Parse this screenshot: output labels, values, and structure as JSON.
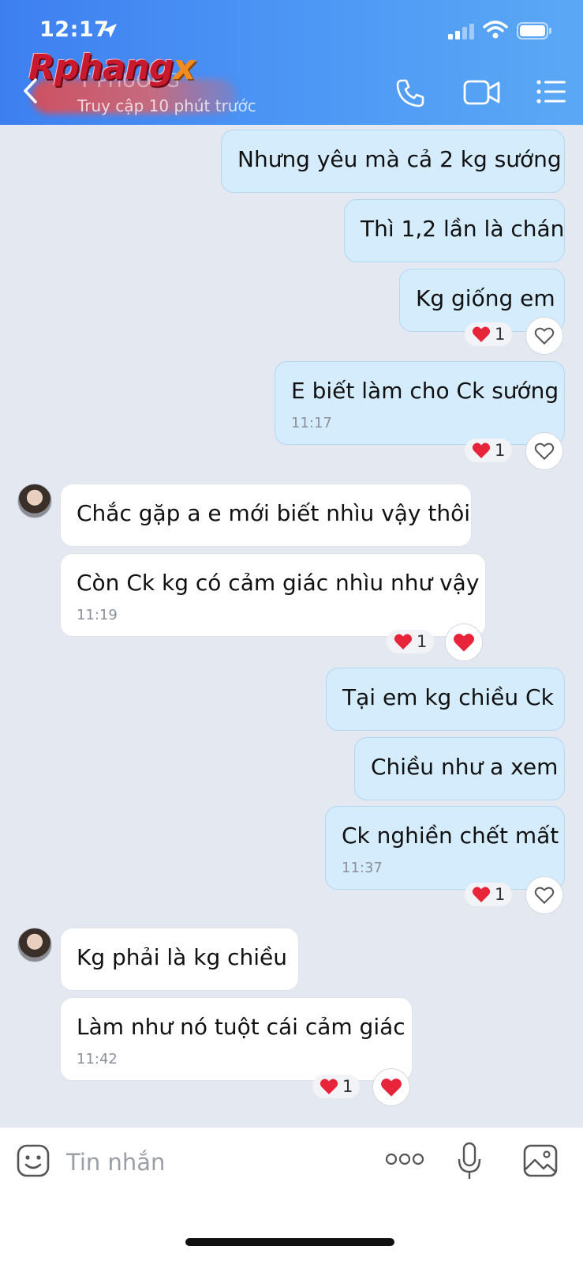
{
  "status_bar": {
    "time": "12:17"
  },
  "header": {
    "brand": "Rphang",
    "brand_x": "x",
    "contact_name": "T PHUONG",
    "last_seen": "Truy cập 10 phút trước"
  },
  "messages": [
    {
      "side": "me",
      "text": "Nhưng yêu mà cả 2 kg sướng"
    },
    {
      "side": "me",
      "text": "Thì 1,2 lần là chán"
    },
    {
      "side": "me",
      "text": "Kg giống em",
      "reaction_count": "1"
    },
    {
      "side": "me",
      "text": "E biết làm cho Ck sướng",
      "time": "11:17",
      "reaction_count": "1"
    },
    {
      "side": "them",
      "text": "Chắc gặp a e mới biết nhìu vậy thôi"
    },
    {
      "side": "them",
      "text": "Còn Ck kg có cảm giác nhìu như vậy",
      "time": "11:19",
      "reaction_count": "1"
    },
    {
      "side": "me",
      "text": "Tại em kg chiều Ck"
    },
    {
      "side": "me",
      "text": "Chiều như a xem"
    },
    {
      "side": "me",
      "text": "Ck nghiền chết mất",
      "time": "11:37",
      "reaction_count": "1"
    },
    {
      "side": "them",
      "text": "Kg phải là kg chiều"
    },
    {
      "side": "them",
      "text": "Làm như nó tuột cái cảm giác",
      "time": "11:42",
      "reaction_count": "1"
    }
  ],
  "composer": {
    "placeholder": "Tin nhắn"
  },
  "colors": {
    "header": "#4a90f2",
    "bubble_me": "#d5ecfd",
    "bubble_them": "#ffffff",
    "heart": "#e8243b",
    "background": "#e4e8f1"
  },
  "icons": [
    "back-icon",
    "call-icon",
    "video-call-icon",
    "menu-icon",
    "sticker-icon",
    "more-icon",
    "mic-icon",
    "image-icon",
    "heart-icon"
  ]
}
